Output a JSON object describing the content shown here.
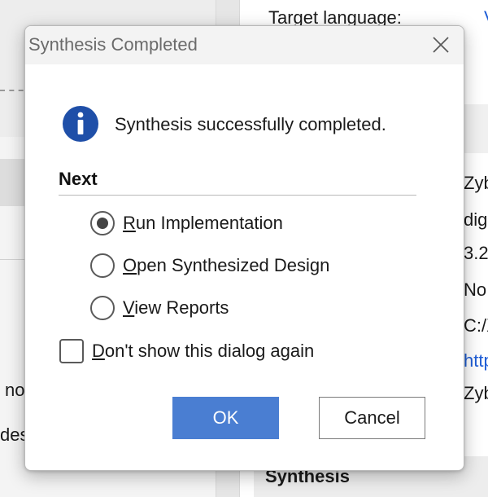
{
  "background": {
    "target_language_label": "Target language:",
    "right_column": [
      "V",
      "Zyb",
      "dig",
      "3.2",
      "No",
      "C:/X",
      "http",
      "Zyb"
    ],
    "left_fragments": [
      "no",
      "des"
    ],
    "section_heading": "Synthesis"
  },
  "dialog": {
    "title": "Synthesis Completed",
    "close_icon": "close-icon",
    "info_icon": "info-icon",
    "message": "Synthesis successfully completed.",
    "section_title": "Next",
    "options": [
      {
        "mnemonic": "R",
        "rest": "un Implementation",
        "selected": true
      },
      {
        "mnemonic": "O",
        "rest": "pen Synthesized Design",
        "selected": false
      },
      {
        "mnemonic": "V",
        "rest": "iew Reports",
        "selected": false
      }
    ],
    "dont_show": {
      "mnemonic": "D",
      "rest": "on't show this dialog again",
      "checked": false
    },
    "ok_label": "OK",
    "cancel_label": "Cancel",
    "colors": {
      "info_icon": "#1f4fa8",
      "ok_button": "#4a7ed2",
      "link": "#1e5dd6"
    }
  }
}
